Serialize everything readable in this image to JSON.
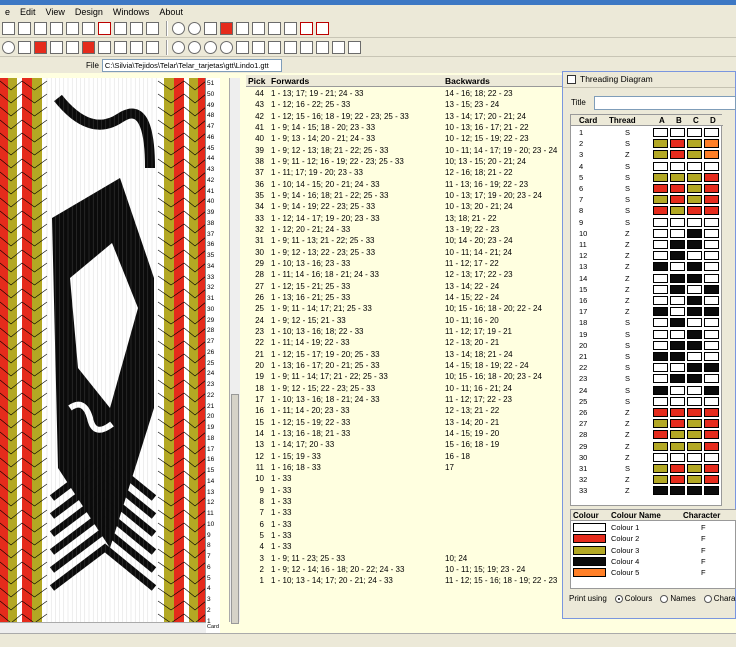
{
  "menu": [
    "e",
    "Edit",
    "View",
    "Design",
    "Windows",
    "About"
  ],
  "file": {
    "label": "File",
    "path": "C:\\Silvia\\Tejidos\\Telar\\Telar_tarjetas\\gtt\\Lindo1.gtt"
  },
  "pattern": {
    "pick_labels": [
      "51",
      "50",
      "49",
      "48",
      "47",
      "46",
      "45",
      "44",
      "43",
      "42",
      "41",
      "40",
      "39",
      "38",
      "37",
      "36",
      "35",
      "34",
      "33",
      "32",
      "31",
      "30",
      "29",
      "28",
      "27",
      "26",
      "25",
      "24",
      "23",
      "22",
      "21",
      "20",
      "19",
      "18",
      "17",
      "16",
      "15",
      "14",
      "13",
      "12",
      "11",
      "10",
      "9",
      "8",
      "7",
      "6",
      "5",
      "4",
      "3",
      "2",
      "1"
    ],
    "bottom_label": "Card",
    "colors": {
      "red": "#e52b1c",
      "olive": "#b3a824",
      "black": "#0b0b0b",
      "white": "#ffffff",
      "orange": "#ff7f27"
    }
  },
  "pick_list": {
    "headers": {
      "pick": "Pick",
      "forwards": "Forwards",
      "backwards": "Backwards"
    },
    "rows": [
      {
        "pick": "44",
        "fwd": "1 - 13; 17; 19 - 21; 24 - 33",
        "bwd": "14 - 16; 18; 22 - 23"
      },
      {
        "pick": "43",
        "fwd": "1 - 12; 16 - 22; 25 - 33",
        "bwd": "13 - 15; 23 - 24"
      },
      {
        "pick": "42",
        "fwd": "1 - 12; 15 - 16; 18 - 19; 22 - 23; 25 - 33",
        "bwd": "13 - 14; 17; 20 - 21; 24"
      },
      {
        "pick": "41",
        "fwd": "1 - 9; 14 - 15; 18 - 20; 23 - 33",
        "bwd": "10 - 13; 16 - 17; 21 - 22"
      },
      {
        "pick": "40",
        "fwd": "1 - 9; 13 - 14; 20 - 21; 24 - 33",
        "bwd": "10 - 12; 15 - 19; 22 - 23"
      },
      {
        "pick": "39",
        "fwd": "1 - 9; 12 - 13; 18; 21 - 22; 25 - 33",
        "bwd": "10 - 11; 14 - 17; 19 - 20; 23 - 24"
      },
      {
        "pick": "38",
        "fwd": "1 - 9; 11 - 12; 16 - 19; 22 - 23; 25 - 33",
        "bwd": "10; 13 - 15; 20 - 21; 24"
      },
      {
        "pick": "37",
        "fwd": "1 - 11; 17; 19 - 20; 23 - 33",
        "bwd": "12 - 16; 18; 21 - 22"
      },
      {
        "pick": "36",
        "fwd": "1 - 10; 14 - 15; 20 - 21; 24 - 33",
        "bwd": "11 - 13; 16 - 19; 22 - 23"
      },
      {
        "pick": "35",
        "fwd": "1 - 9; 14 - 16; 18; 21 - 22; 25 - 33",
        "bwd": "10 - 13; 17; 19 - 20; 23 - 24"
      },
      {
        "pick": "34",
        "fwd": "1 - 9; 14 - 19; 22 - 23; 25 - 33",
        "bwd": "10 - 13; 20 - 21; 24"
      },
      {
        "pick": "33",
        "fwd": "1 - 12; 14 - 17; 19 - 20; 23 - 33",
        "bwd": "13; 18; 21 - 22"
      },
      {
        "pick": "32",
        "fwd": "1 - 12; 20 - 21; 24 - 33",
        "bwd": "13 - 19; 22 - 23"
      },
      {
        "pick": "31",
        "fwd": "1 - 9; 11 - 13; 21 - 22; 25 - 33",
        "bwd": "10; 14 - 20; 23 - 24"
      },
      {
        "pick": "30",
        "fwd": "1 - 9; 12 - 13; 22 - 23; 25 - 33",
        "bwd": "10 - 11; 14 - 21; 24"
      },
      {
        "pick": "29",
        "fwd": "1 - 10; 13 - 16; 23 - 33",
        "bwd": "11 - 12; 17 - 22"
      },
      {
        "pick": "28",
        "fwd": "1 - 11; 14 - 16; 18 - 21; 24 - 33",
        "bwd": "12 - 13; 17; 22 - 23"
      },
      {
        "pick": "27",
        "fwd": "1 - 12; 15 - 21; 25 - 33",
        "bwd": "13 - 14; 22 - 24"
      },
      {
        "pick": "26",
        "fwd": "1 - 13; 16 - 21; 25 - 33",
        "bwd": "14 - 15; 22 - 24"
      },
      {
        "pick": "25",
        "fwd": "1 - 9; 11 - 14; 17; 21; 25 - 33",
        "bwd": "10; 15 - 16; 18 - 20; 22 - 24"
      },
      {
        "pick": "24",
        "fwd": "1 - 9; 12 - 15; 21 - 33",
        "bwd": "10 - 11; 16 - 20"
      },
      {
        "pick": "23",
        "fwd": "1 - 10; 13 - 16; 18; 22 - 33",
        "bwd": "11 - 12; 17; 19 - 21"
      },
      {
        "pick": "22",
        "fwd": "1 - 11; 14 - 19; 22 - 33",
        "bwd": "12 - 13; 20 - 21"
      },
      {
        "pick": "21",
        "fwd": "1 - 12; 15 - 17; 19 - 20; 25 - 33",
        "bwd": "13 - 14; 18; 21 - 24"
      },
      {
        "pick": "20",
        "fwd": "1 - 13; 16 - 17; 20 - 21; 25 - 33",
        "bwd": "14 - 15; 18 - 19; 22 - 24"
      },
      {
        "pick": "19",
        "fwd": "1 - 9; 11 - 14; 17; 21 - 22; 25 - 33",
        "bwd": "10; 15 - 16; 18 - 20; 23 - 24"
      },
      {
        "pick": "18",
        "fwd": "1 - 9; 12 - 15; 22 - 23; 25 - 33",
        "bwd": "10 - 11; 16 - 21; 24"
      },
      {
        "pick": "17",
        "fwd": "1 - 10; 13 - 16; 18 - 21; 24 - 33",
        "bwd": "11 - 12; 17; 22 - 23"
      },
      {
        "pick": "16",
        "fwd": "1 - 11; 14 - 20; 23 - 33",
        "bwd": "12 - 13; 21 - 22"
      },
      {
        "pick": "15",
        "fwd": "1 - 12; 15 - 19; 22 - 33",
        "bwd": "13 - 14; 20 - 21"
      },
      {
        "pick": "14",
        "fwd": "1 - 13; 16 - 18; 21 - 33",
        "bwd": "14 - 15; 19 - 20"
      },
      {
        "pick": "13",
        "fwd": "1 - 14; 17; 20 - 33",
        "bwd": "15 - 16; 18 - 19"
      },
      {
        "pick": "12",
        "fwd": "1 - 15; 19 - 33",
        "bwd": "16 - 18"
      },
      {
        "pick": "11",
        "fwd": "1 - 16; 18 - 33",
        "bwd": "17"
      },
      {
        "pick": "10",
        "fwd": "1 - 33",
        "bwd": ""
      },
      {
        "pick": "9",
        "fwd": "1 - 33",
        "bwd": ""
      },
      {
        "pick": "8",
        "fwd": "1 - 33",
        "bwd": ""
      },
      {
        "pick": "7",
        "fwd": "1 - 33",
        "bwd": ""
      },
      {
        "pick": "6",
        "fwd": "1 - 33",
        "bwd": ""
      },
      {
        "pick": "5",
        "fwd": "1 - 33",
        "bwd": ""
      },
      {
        "pick": "4",
        "fwd": "1 - 33",
        "bwd": ""
      },
      {
        "pick": "3",
        "fwd": "1 - 9; 11 - 23; 25 - 33",
        "bwd": "10; 24"
      },
      {
        "pick": "2",
        "fwd": "1 - 9; 12 - 14; 16 - 18; 20 - 22; 24 - 33",
        "bwd": "10 - 11; 15; 19; 23 - 24"
      },
      {
        "pick": "1",
        "fwd": "1 - 10; 13 - 14; 17; 20 - 21; 24 - 33",
        "bwd": "11 - 12; 15 - 16; 18 - 19; 22 - 23"
      }
    ]
  },
  "threading": {
    "window_title": "Threading Diagram",
    "title_label": "Title",
    "title_value": "",
    "headers": {
      "card": "Card",
      "thread": "Thread",
      "a": "A",
      "b": "B",
      "c": "C",
      "d": "D"
    },
    "cards": [
      {
        "card": "1",
        "thread": "S",
        "holes": [
          "W",
          "W",
          "W",
          "W"
        ]
      },
      {
        "card": "2",
        "thread": "S",
        "holes": [
          "O",
          "R",
          "O",
          "OR"
        ]
      },
      {
        "card": "3",
        "thread": "Z",
        "holes": [
          "O",
          "R",
          "O",
          "OR"
        ]
      },
      {
        "card": "4",
        "thread": "S",
        "holes": [
          "W",
          "W",
          "W",
          "W"
        ]
      },
      {
        "card": "5",
        "thread": "S",
        "holes": [
          "O",
          "O",
          "O",
          "R"
        ]
      },
      {
        "card": "6",
        "thread": "S",
        "holes": [
          "R",
          "R",
          "O",
          "R"
        ]
      },
      {
        "card": "7",
        "thread": "S",
        "holes": [
          "O",
          "R",
          "O",
          "R"
        ]
      },
      {
        "card": "8",
        "thread": "S",
        "holes": [
          "R",
          "O",
          "R",
          "R"
        ]
      },
      {
        "card": "9",
        "thread": "S",
        "holes": [
          "W",
          "W",
          "W",
          "W"
        ]
      },
      {
        "card": "10",
        "thread": "Z",
        "holes": [
          "W",
          "W",
          "K",
          "W"
        ]
      },
      {
        "card": "11",
        "thread": "Z",
        "holes": [
          "W",
          "K",
          "K",
          "W"
        ]
      },
      {
        "card": "12",
        "thread": "Z",
        "holes": [
          "W",
          "K",
          "W",
          "W"
        ]
      },
      {
        "card": "13",
        "thread": "Z",
        "holes": [
          "K",
          "W",
          "K",
          "W"
        ]
      },
      {
        "card": "14",
        "thread": "Z",
        "holes": [
          "W",
          "K",
          "K",
          "W"
        ]
      },
      {
        "card": "15",
        "thread": "Z",
        "holes": [
          "W",
          "K",
          "W",
          "K"
        ]
      },
      {
        "card": "16",
        "thread": "Z",
        "holes": [
          "W",
          "W",
          "K",
          "W"
        ]
      },
      {
        "card": "17",
        "thread": "Z",
        "holes": [
          "K",
          "W",
          "K",
          "K"
        ]
      },
      {
        "card": "18",
        "thread": "S",
        "holes": [
          "W",
          "K",
          "W",
          "W"
        ]
      },
      {
        "card": "19",
        "thread": "S",
        "holes": [
          "W",
          "W",
          "K",
          "W"
        ]
      },
      {
        "card": "20",
        "thread": "S",
        "holes": [
          "W",
          "K",
          "K",
          "W"
        ]
      },
      {
        "card": "21",
        "thread": "S",
        "holes": [
          "K",
          "K",
          "W",
          "W"
        ]
      },
      {
        "card": "22",
        "thread": "S",
        "holes": [
          "W",
          "W",
          "K",
          "K"
        ]
      },
      {
        "card": "23",
        "thread": "S",
        "holes": [
          "W",
          "K",
          "K",
          "W"
        ]
      },
      {
        "card": "24",
        "thread": "S",
        "holes": [
          "K",
          "W",
          "W",
          "K"
        ]
      },
      {
        "card": "25",
        "thread": "S",
        "holes": [
          "W",
          "W",
          "W",
          "W"
        ]
      },
      {
        "card": "26",
        "thread": "Z",
        "holes": [
          "R",
          "R",
          "R",
          "R"
        ]
      },
      {
        "card": "27",
        "thread": "Z",
        "holes": [
          "O",
          "R",
          "O",
          "R"
        ]
      },
      {
        "card": "28",
        "thread": "Z",
        "holes": [
          "R",
          "O",
          "O",
          "R"
        ]
      },
      {
        "card": "29",
        "thread": "Z",
        "holes": [
          "O",
          "O",
          "O",
          "R"
        ]
      },
      {
        "card": "30",
        "thread": "Z",
        "holes": [
          "W",
          "W",
          "W",
          "W"
        ]
      },
      {
        "card": "31",
        "thread": "S",
        "holes": [
          "O",
          "R",
          "O",
          "R"
        ]
      },
      {
        "card": "32",
        "thread": "Z",
        "holes": [
          "O",
          "R",
          "O",
          "R"
        ]
      },
      {
        "card": "33",
        "thread": "Z",
        "holes": [
          "K",
          "K",
          "K",
          "K"
        ]
      }
    ],
    "colour_headers": {
      "colour": "Colour",
      "name": "Colour Name",
      "character": "Character"
    },
    "colours": [
      {
        "hex": "#ffffff",
        "name": "Colour 1",
        "char": "F"
      },
      {
        "hex": "#e52b1c",
        "name": "Colour 2",
        "char": "F"
      },
      {
        "hex": "#b3a824",
        "name": "Colour 3",
        "char": "F"
      },
      {
        "hex": "#0b0b0b",
        "name": "Colour 4",
        "char": "F"
      },
      {
        "hex": "#ff7f27",
        "name": "Colour 5",
        "char": "F"
      }
    ],
    "print_label": "Print using",
    "print_options": [
      "Colours",
      "Names",
      "Chara"
    ]
  }
}
